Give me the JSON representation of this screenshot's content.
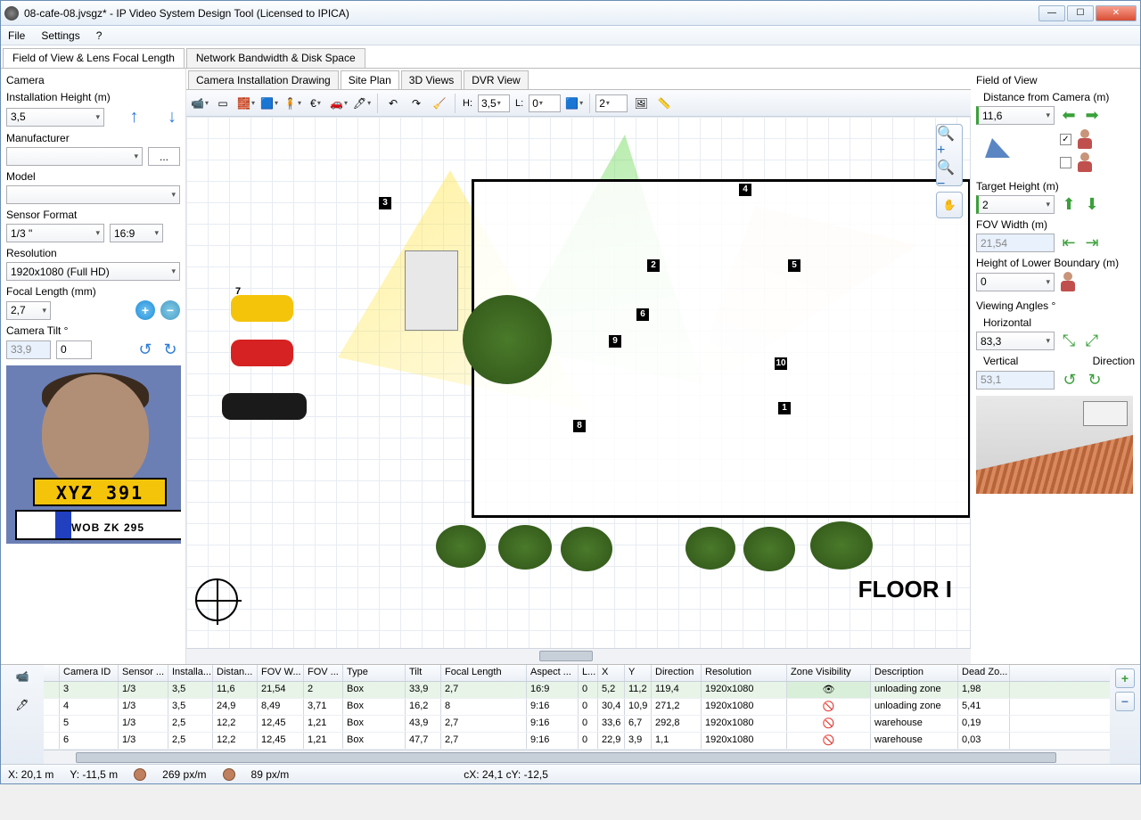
{
  "titlebar": {
    "title": "08-cafe-08.jvsgz* - IP Video System Design Tool (Licensed to IPICA)"
  },
  "menu": {
    "file": "File",
    "settings": "Settings",
    "help": "?"
  },
  "main_tabs": {
    "fov": "Field of View & Lens Focal Length",
    "net": "Network Bandwidth & Disk Space"
  },
  "left": {
    "camera": "Camera",
    "install_h": "Installation Height (m)",
    "install_h_val": "3,5",
    "manufacturer": "Manufacturer",
    "manufacturer_val": "",
    "model": "Model",
    "model_val": "",
    "sensor_fmt": "Sensor Format",
    "sensor_fmt_val": "1/3 \"",
    "aspect": "16:9",
    "resolution": "Resolution",
    "resolution_val": "1920x1080 (Full HD)",
    "focal": "Focal Length (mm)",
    "focal_val": "2,7",
    "tilt": "Camera Tilt °",
    "tilt_val": "33,9",
    "tilt_val2": "0",
    "plate1": "XYZ 391",
    "plate2": "WOB ZK 295"
  },
  "sub_tabs": {
    "a": "Camera Installation Drawing",
    "b": "Site Plan",
    "c": "3D Views",
    "d": "DVR View"
  },
  "toolbar": {
    "h_lbl": "H:",
    "h_val": "3,5",
    "l_lbl": "L:",
    "l_val": "0",
    "scale_val": "2"
  },
  "right": {
    "fov": "Field of View",
    "dist": "Distance from Camera  (m)",
    "dist_val": "11,6",
    "target_h": "Target Height (m)",
    "target_h_val": "2",
    "fov_w": "FOV Width (m)",
    "fov_w_val": "21,54",
    "lower_b": "Height of Lower Boundary (m)",
    "lower_b_val": "0",
    "angles": "Viewing Angles °",
    "horiz": "Horizontal",
    "horiz_val": "83,3",
    "vert": "Vertical",
    "vert_val": "53,1",
    "dir": "Direction"
  },
  "table": {
    "headers": [
      "",
      "Camera ID",
      "Sensor ...",
      "Installa...",
      "Distan...",
      "FOV W...",
      "FOV ...",
      "Type",
      "Tilt",
      "Focal Length",
      "Aspect ...",
      "L...",
      "X",
      "Y",
      "Direction",
      "Resolution",
      "Zone Visibility",
      "Description",
      "Dead Zo..."
    ],
    "widths": [
      18,
      66,
      56,
      50,
      50,
      52,
      44,
      70,
      40,
      96,
      58,
      22,
      30,
      30,
      56,
      96,
      94,
      98,
      58
    ],
    "rows": [
      [
        "",
        "3",
        "1/3",
        "3,5",
        "11,6",
        "21,54",
        "2",
        "Box",
        "33,9",
        "2,7",
        "16:9",
        "0",
        "5,2",
        "11,2",
        "119,4",
        "1920x1080",
        "👁",
        "unloading zone",
        "1,98"
      ],
      [
        "",
        "4",
        "1/3",
        "3,5",
        "24,9",
        "8,49",
        "3,71",
        "Box",
        "16,2",
        "8",
        "9:16",
        "0",
        "30,4",
        "10,9",
        "271,2",
        "1920x1080",
        "👁",
        "unloading zone",
        "5,41"
      ],
      [
        "",
        "5",
        "1/3",
        "2,5",
        "12,2",
        "12,45",
        "1,21",
        "Box",
        "43,9",
        "2,7",
        "9:16",
        "0",
        "33,6",
        "6,7",
        "292,8",
        "1920x1080",
        "👁",
        "warehouse",
        "0,19"
      ],
      [
        "",
        "6",
        "1/3",
        "2,5",
        "12,2",
        "12,45",
        "1,21",
        "Box",
        "47,7",
        "2,7",
        "9:16",
        "0",
        "22,9",
        "3,9",
        "1,1",
        "1920x1080",
        "👁",
        "warehouse",
        "0,03"
      ]
    ]
  },
  "status": {
    "x": "X: 20,1 m",
    "y": "Y: -11,5 m",
    "px": "269 px/m",
    "px2": "89 px/m",
    "c": "cX: 24,1 cY: -12,5"
  },
  "floor": {
    "label": "FLOOR I"
  },
  "markers": [
    "1",
    "2",
    "3",
    "4",
    "5",
    "6",
    "7",
    "8",
    "9",
    "10"
  ]
}
